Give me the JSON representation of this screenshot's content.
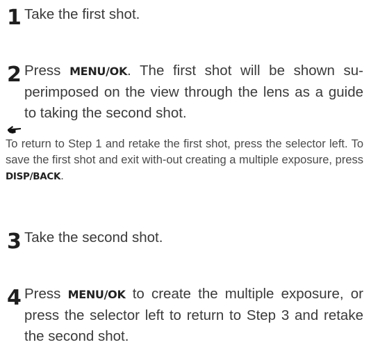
{
  "steps": [
    {
      "number": "1",
      "text": "Take the first shot."
    },
    {
      "number": "2",
      "pre": "Press ",
      "keyword": "MENU/OK",
      "post": ". The first shot will be shown su-perimposed on the view through the lens as a guide to taking the second shot."
    },
    {
      "number": "3",
      "text": "Take the second shot."
    },
    {
      "number": "4",
      "pre": "Press ",
      "keyword": "MENU/OK",
      "post": " to create the multiple exposure, or press the selector left to return to Step 3 and retake the second shot."
    }
  ],
  "note": {
    "icon": "pointing-hand-icon",
    "pre": "To return to Step 1 and retake the first shot, press the selector left. To save the first shot and exit with-out creating a multiple exposure, press ",
    "keyword": "DISP/BACK",
    "post": "."
  }
}
